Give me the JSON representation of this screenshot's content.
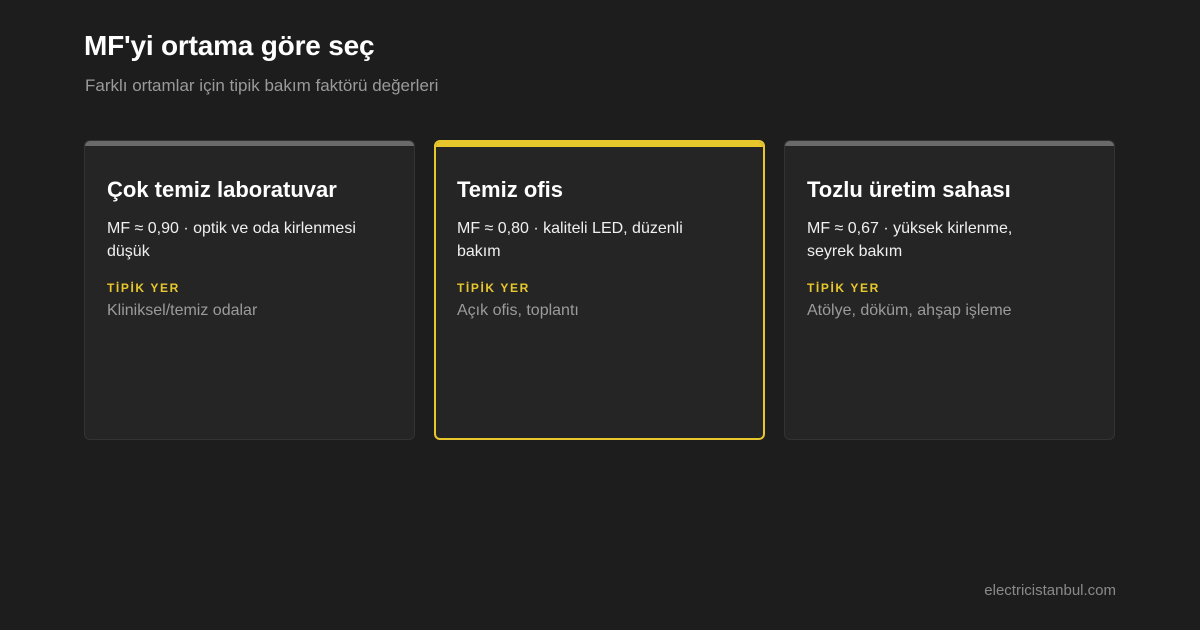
{
  "header": {
    "title": "MF'yi ortama göre seç",
    "subtitle": "Farklı ortamlar için tipik bakım faktörü değerleri"
  },
  "cards": [
    {
      "title": "Çok temiz laboratuvar",
      "description": "MF ≈ 0,90 · optik ve oda kirlenmesi düşük",
      "label": "TİPİK YER",
      "value": "Kliniksel/temiz odalar",
      "selected": false
    },
    {
      "title": "Temiz ofis",
      "description": "MF ≈ 0,80 · kaliteli LED, düzenli bakım",
      "label": "TİPİK YER",
      "value": "Açık ofis, toplantı",
      "selected": true
    },
    {
      "title": "Tozlu üretim sahası",
      "description": "MF ≈ 0,67 · yüksek kirlenme, seyrek bakım",
      "label": "TİPİK YER",
      "value": "Atölye, döküm, ahşap işleme",
      "selected": false
    }
  ],
  "footer": {
    "brand": "electricistanbul.com"
  },
  "colors": {
    "background": "#1d1d1d",
    "card": "#252525",
    "accent": "#e8c72d",
    "muted_bar": "#6a6a6a"
  }
}
